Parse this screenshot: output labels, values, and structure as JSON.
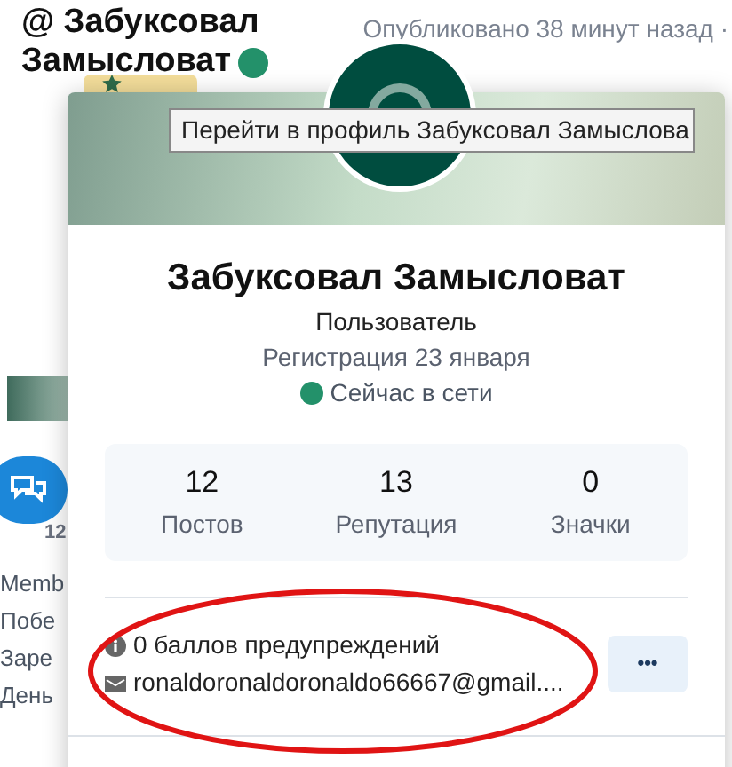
{
  "post": {
    "author_line_1": "@ Забуксовал",
    "author_line_2": "Замысловат",
    "author_online": true,
    "published": "Опубликовано 38 минут назад ·",
    "comments_count": "12",
    "side_labels": [
      "Memb",
      "Побе",
      "Заре",
      "День"
    ]
  },
  "tooltip": {
    "text": "Перейти в профиль Забуксовал Замыслова"
  },
  "profile_card": {
    "name": "Забуксовал Замысловат",
    "role": "Пользователь",
    "registered": "Регистрация 23 января",
    "online": true,
    "status": "Сейчас в сети",
    "stats": [
      {
        "value": "12",
        "label": "Постов"
      },
      {
        "value": "13",
        "label": "Репутация"
      },
      {
        "value": "0",
        "label": "Значки"
      }
    ],
    "details": [
      {
        "kind": "info",
        "text": "0 баллов предупреждений"
      },
      {
        "kind": "mail",
        "text": "ronaldoronaldoronaldo66667@gmail...."
      }
    ],
    "more_button": "•••"
  }
}
